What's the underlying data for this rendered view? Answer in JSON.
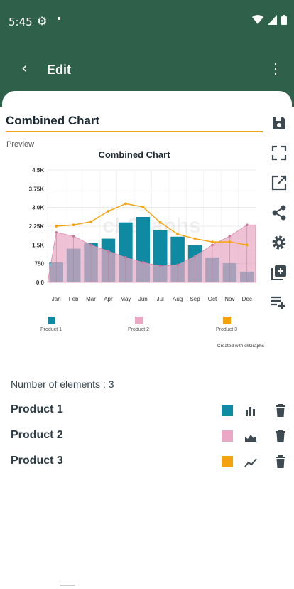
{
  "status_bar": {
    "time": "5:45"
  },
  "toolbar": {
    "title": "Edit"
  },
  "editor": {
    "chart_name": "Combined Chart",
    "preview_label": "Preview"
  },
  "chart_data": {
    "type": "bar",
    "title": "Combined Chart",
    "categories": [
      "Jan",
      "Feb",
      "Mar",
      "Apr",
      "May",
      "Jun",
      "Jul",
      "Aug",
      "Sep",
      "Oct",
      "Nov",
      "Dec"
    ],
    "ylim": [
      0,
      4500
    ],
    "yticks": [
      "0.0",
      "750",
      "1.5K",
      "2.25K",
      "3.0K",
      "3.75K",
      "4.5K"
    ],
    "series": [
      {
        "name": "Product 1",
        "kind": "bar",
        "color": "#0e8aa3",
        "values": [
          800,
          1350,
          1580,
          1750,
          2400,
          2620,
          2080,
          1830,
          1500,
          1000,
          770,
          430
        ]
      },
      {
        "name": "Product 2",
        "kind": "area",
        "color": "#e9a9c4",
        "values": [
          2000,
          1850,
          1500,
          1250,
          1000,
          800,
          650,
          700,
          1050,
          1500,
          1850,
          2300
        ]
      },
      {
        "name": "Product 3",
        "kind": "line",
        "color": "#f4a20f",
        "values": [
          2250,
          2300,
          2430,
          2850,
          3150,
          3020,
          2400,
          1930,
          1750,
          1620,
          1620,
          1500
        ]
      }
    ],
    "grid": true,
    "legend": "bottom",
    "watermark": "ckGraphs",
    "credit": "Created with ckGraphs"
  },
  "elements": {
    "count_label": "Number of elements : 3",
    "items": [
      {
        "name": "Product 1",
        "color": "#0e8aa3",
        "type_icon": "bar-chart-icon"
      },
      {
        "name": "Product 2",
        "color": "#e9a9c4",
        "type_icon": "area-chart-icon"
      },
      {
        "name": "Product 3",
        "color": "#f4a20f",
        "type_icon": "line-chart-icon"
      }
    ]
  }
}
